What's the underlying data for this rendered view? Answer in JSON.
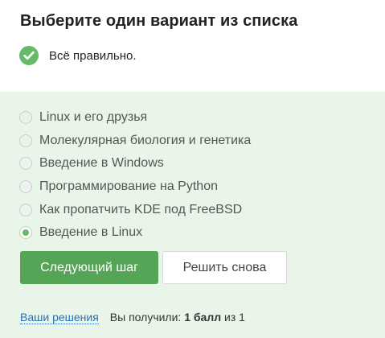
{
  "question": {
    "title": "Выберите один вариант из списка"
  },
  "result": {
    "icon": "check-circle-icon",
    "text": "Всё правильно.",
    "color": "#66bb6a"
  },
  "options": [
    {
      "label": "Linux и его друзья",
      "selected": false
    },
    {
      "label": "Молекулярная биология и генетика",
      "selected": false
    },
    {
      "label": "Введение в Windows",
      "selected": false
    },
    {
      "label": "Программирование на Python",
      "selected": false
    },
    {
      "label": "Как пропатчить KDE под FreeBSD",
      "selected": false
    },
    {
      "label": "Введение в Linux",
      "selected": true
    }
  ],
  "actions": {
    "next_label": "Следующий шаг",
    "retry_label": "Решить снова"
  },
  "footer": {
    "solutions_link": "Ваши решения",
    "score_prefix": "Вы получили:",
    "score_value": "1 балл",
    "score_suffix": "из 1"
  },
  "colors": {
    "accent": "#54a556",
    "panel_bg": "#e9f5e9",
    "link": "#2c6fb4"
  }
}
